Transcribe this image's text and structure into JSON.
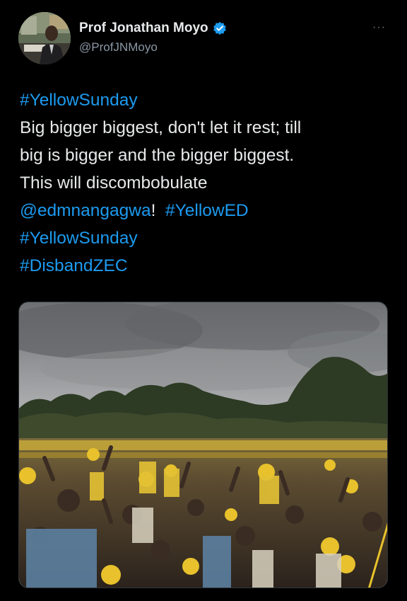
{
  "author": {
    "display_name": "Prof Jonathan Moyo",
    "handle": "@ProfJNMoyo",
    "verified": true,
    "avatar": "profile-photo"
  },
  "more_menu": {
    "label": "···",
    "icon": "more-options-icon"
  },
  "tweet": {
    "line1_hashtag": "#YellowSunday",
    "line2": "Big bigger biggest, don't let it rest; till",
    "line3": "big is bigger and the bigger biggest.",
    "line4": "This will discombobulate",
    "mention": "@edmnangagwa",
    "mention_suffix": "!",
    "hashtag_yellowed": "#YellowED",
    "hashtag_yellowsunday": "#YellowSunday",
    "hashtag_disbandzec": "#DisbandZEC"
  },
  "media": {
    "type": "photo",
    "description_icon": "rally-crowd-photo"
  },
  "colors": {
    "background": "#000000",
    "text": "#e7e9ea",
    "link": "#1d9bf0",
    "secondary": "#8b98a5",
    "verified_badge": "#1d9bf0"
  }
}
